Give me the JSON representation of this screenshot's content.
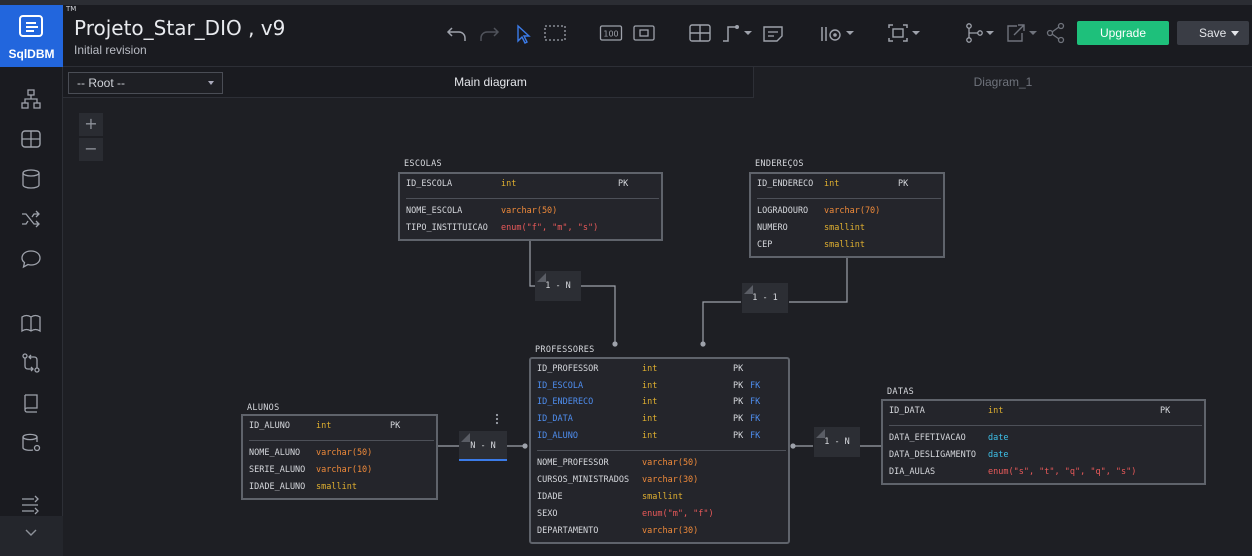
{
  "app": {
    "logo_text": "SqlDBM",
    "tm": "TM",
    "title": "Projeto_Star_DIO , v9",
    "subtitle": "Initial revision",
    "upgrade_label": "Upgrade",
    "save_label": "Save"
  },
  "subheader": {
    "root_select": "-- Root --",
    "tabs": [
      {
        "label": "Main diagram",
        "active": true
      },
      {
        "label": "Diagram_1",
        "active": false
      }
    ]
  },
  "canvas": {
    "zoom_in": "+",
    "zoom_out": "−"
  },
  "tables": {
    "escolas": {
      "name": "ESCOLAS",
      "rows": [
        {
          "col": "ID_ESCOLA",
          "type": "int",
          "key": "PK",
          "fk": ""
        },
        {
          "col": "NOME_ESCOLA",
          "type": "varchar(50)",
          "key": "",
          "fk": ""
        },
        {
          "col": "TIPO_INSTITUICAO",
          "type": "enum(\"f\", \"m\", \"s\")",
          "key": "",
          "fk": ""
        }
      ]
    },
    "enderecos": {
      "name": "ENDEREÇOS",
      "rows": [
        {
          "col": "ID_ENDERECO",
          "type": "int",
          "key": "PK",
          "fk": ""
        },
        {
          "col": "LOGRADOURO",
          "type": "varchar(70)",
          "key": "",
          "fk": ""
        },
        {
          "col": "NUMERO",
          "type": "smallint",
          "key": "",
          "fk": ""
        },
        {
          "col": "CEP",
          "type": "smallint",
          "key": "",
          "fk": ""
        }
      ]
    },
    "professores": {
      "name": "PROFESSORES",
      "rows": [
        {
          "col": "ID_PROFESSOR",
          "type": "int",
          "key": "PK",
          "fk": ""
        },
        {
          "col": "ID_ESCOLA",
          "type": "int",
          "key": "PK",
          "fk": "FK"
        },
        {
          "col": "ID_ENDERECO",
          "type": "int",
          "key": "PK",
          "fk": "FK"
        },
        {
          "col": "ID_DATA",
          "type": "int",
          "key": "PK",
          "fk": "FK"
        },
        {
          "col": "ID_ALUNO",
          "type": "int",
          "key": "PK",
          "fk": "FK"
        },
        {
          "col": "NOME_PROFESSOR",
          "type": "varchar(50)",
          "key": "",
          "fk": ""
        },
        {
          "col": "CURSOS_MINISTRADOS",
          "type": "varchar(30)",
          "key": "",
          "fk": ""
        },
        {
          "col": "IDADE",
          "type": "smallint",
          "key": "",
          "fk": ""
        },
        {
          "col": "SEXO",
          "type": "enum(\"m\", \"f\")",
          "key": "",
          "fk": ""
        },
        {
          "col": "DEPARTAMENTO",
          "type": "varchar(30)",
          "key": "",
          "fk": ""
        }
      ]
    },
    "alunos": {
      "name": "ALUNOS",
      "rows": [
        {
          "col": "ID_ALUNO",
          "type": "int",
          "key": "PK",
          "fk": ""
        },
        {
          "col": "NOME_ALUNO",
          "type": "varchar(50)",
          "key": "",
          "fk": ""
        },
        {
          "col": "SERIE_ALUNO",
          "type": "varchar(10)",
          "key": "",
          "fk": ""
        },
        {
          "col": "IDADE_ALUNO",
          "type": "smallint",
          "key": "",
          "fk": ""
        }
      ]
    },
    "datas": {
      "name": "DATAS",
      "rows": [
        {
          "col": "ID_DATA",
          "type": "int",
          "key": "PK",
          "fk": ""
        },
        {
          "col": "DATA_EFETIVACAO",
          "type": "date",
          "key": "",
          "fk": ""
        },
        {
          "col": "DATA_DESLIGAMENTO",
          "type": "date",
          "key": "",
          "fk": ""
        },
        {
          "col": "DIA_AULAS",
          "type": "enum(\"s\", \"t\", \"q\", \"q\", \"s\")",
          "key": "",
          "fk": ""
        }
      ]
    }
  },
  "relations": {
    "escolas_professores": "1 - N",
    "enderecos_professores": "1 - 1",
    "alunos_professores": "N - N",
    "professores_datas": "1 - N"
  },
  "colors": {
    "accent": "#2266dd",
    "upgrade": "#1ec07b",
    "fk_column": "#4e8dee",
    "type_int": "#e0b030",
    "type_varchar": "#ef8a3a",
    "type_enum": "#ea5a5a",
    "type_date": "#3ec0e8"
  }
}
